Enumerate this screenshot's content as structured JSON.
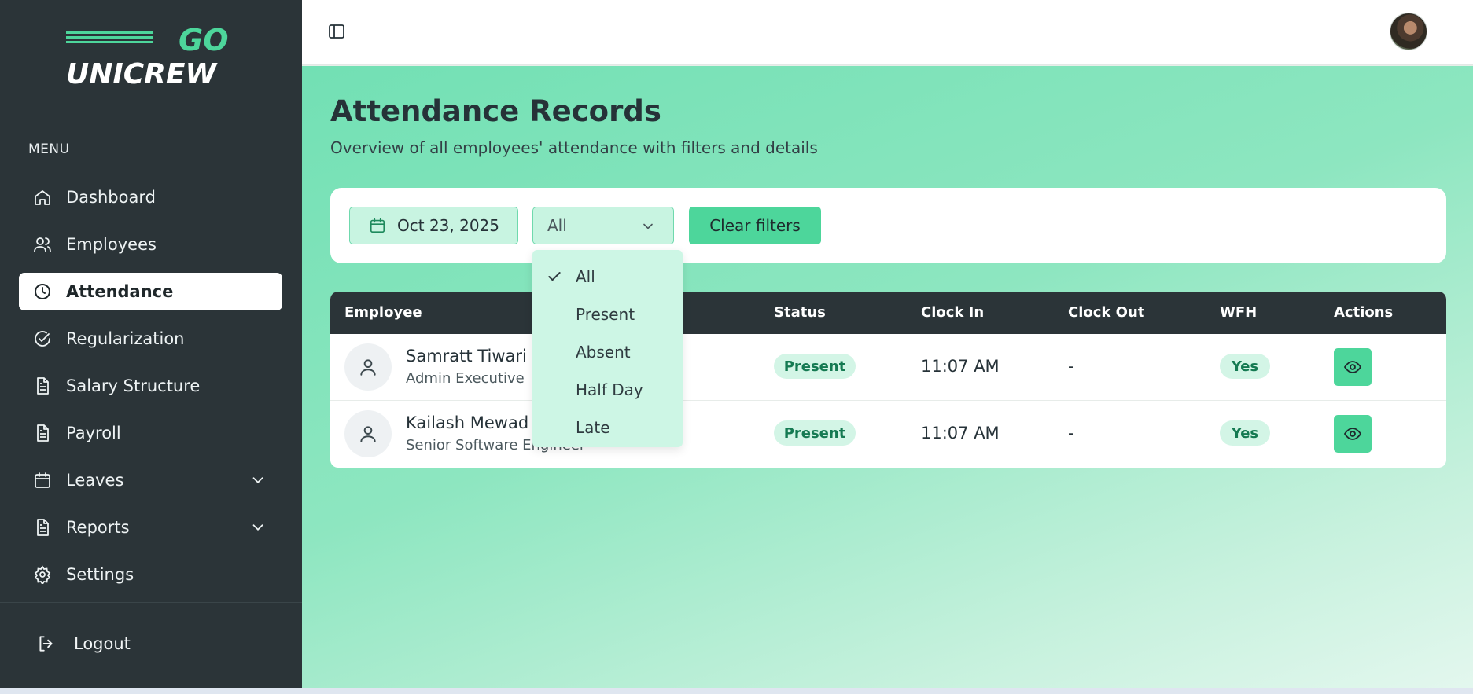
{
  "app": {
    "logo_text_top": "GO",
    "logo_text_bottom": "UNICREW",
    "brand_color": "#4dd69b",
    "sidebar_color": "#2b3438"
  },
  "sidebar": {
    "menu_label": "MENU",
    "items": [
      {
        "label": "Dashboard",
        "icon": "home-icon"
      },
      {
        "label": "Employees",
        "icon": "users-icon"
      },
      {
        "label": "Attendance",
        "icon": "clock-icon",
        "active": true
      },
      {
        "label": "Regularization",
        "icon": "check-circle-icon"
      },
      {
        "label": "Salary Structure",
        "icon": "document-icon"
      },
      {
        "label": "Payroll",
        "icon": "document-icon"
      },
      {
        "label": "Leaves",
        "icon": "calendar-icon",
        "expandable": true
      },
      {
        "label": "Reports",
        "icon": "document-icon",
        "expandable": true
      },
      {
        "label": "Settings",
        "icon": "gear-icon"
      }
    ],
    "logout_label": "Logout"
  },
  "page": {
    "title": "Attendance Records",
    "subtitle": "Overview of all employees' attendance with filters and details"
  },
  "filters": {
    "date": "Oct 23, 2025",
    "status_selected": "All",
    "clear_label": "Clear filters"
  },
  "dropdown": {
    "options": [
      "All",
      "Present",
      "Absent",
      "Half Day",
      "Late"
    ],
    "selected": "All"
  },
  "table": {
    "columns": [
      "Employee",
      "Status",
      "Clock In",
      "Clock Out",
      "WFH",
      "Actions"
    ],
    "rows": [
      {
        "name": "Samratt Tiwari",
        "role": "Admin Executive",
        "status": "Present",
        "clock_in": "11:07 AM",
        "clock_out": "-",
        "wfh": "Yes"
      },
      {
        "name": "Kailash Mewad",
        "role": "Senior Software Engineer",
        "status": "Present",
        "clock_in": "11:07 AM",
        "clock_out": "-",
        "wfh": "Yes"
      }
    ]
  }
}
